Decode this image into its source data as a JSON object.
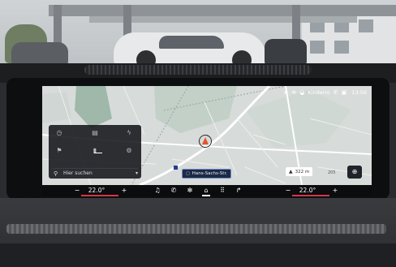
{
  "status_bar": {
    "profile": "Kinderro",
    "time": "13:56",
    "icons": [
      "location-arrow-icon",
      "hotspot-icon",
      "car-profile-icon",
      "phone-icon",
      "message-icon"
    ]
  },
  "nav_widget": {
    "icons_row1": [
      "route-history-icon",
      "calendar-icon",
      "charging-icon"
    ],
    "icons_row2": [
      "flag-icon",
      "fuel-icon",
      "settings-icon"
    ],
    "search_label": "Hier suchen"
  },
  "map": {
    "street": "Hans-Sachs-Str.",
    "altitude": "322 m",
    "distance_hint": "205"
  },
  "climate": {
    "left_temp": "22.0°",
    "right_temp": "22.0°",
    "minus": "−",
    "plus": "+",
    "media_icons": [
      "music-icon",
      "phone-call-icon",
      "fan-icon",
      "home-icon",
      "apps-icon",
      "navigation-icon"
    ]
  },
  "colors": {
    "accent_red": "#d6354a",
    "nav_orange": "#e2542c",
    "street_blue": "#1c2a44"
  }
}
